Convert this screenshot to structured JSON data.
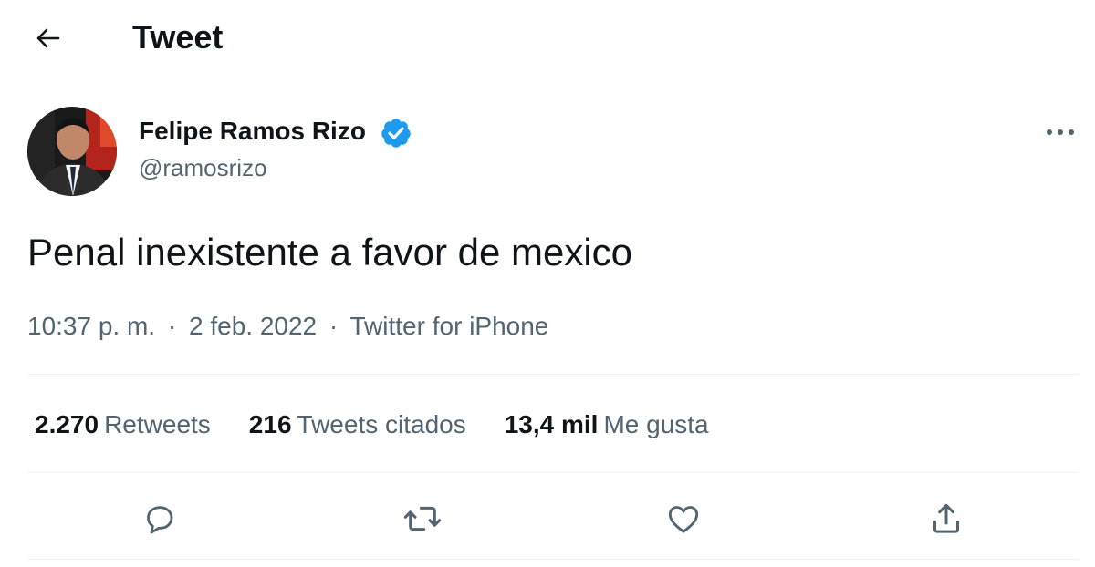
{
  "header": {
    "title": "Tweet",
    "back_icon": "arrow-left-icon"
  },
  "author": {
    "name": "Felipe Ramos Rizo",
    "handle": "@ramosrizo",
    "verified_icon": "verified-badge-icon",
    "verified_color": "#1d9bf0"
  },
  "tweet": {
    "text": "Penal inexistente a favor de mexico",
    "time": "10:37 p. m.",
    "separator": "·",
    "date": "2 feb. 2022",
    "source": "Twitter for iPhone"
  },
  "stats": [
    {
      "value": "2.270",
      "label": "Retweets"
    },
    {
      "value": "216",
      "label": "Tweets citados"
    },
    {
      "value": "13,4 mil",
      "label": "Me gusta"
    }
  ],
  "actions": [
    "reply-icon",
    "retweet-icon",
    "like-icon",
    "share-icon"
  ],
  "colors": {
    "text": "#0f1419",
    "secondary": "#536471",
    "divider": "#eff3f4",
    "accent": "#1d9bf0"
  }
}
